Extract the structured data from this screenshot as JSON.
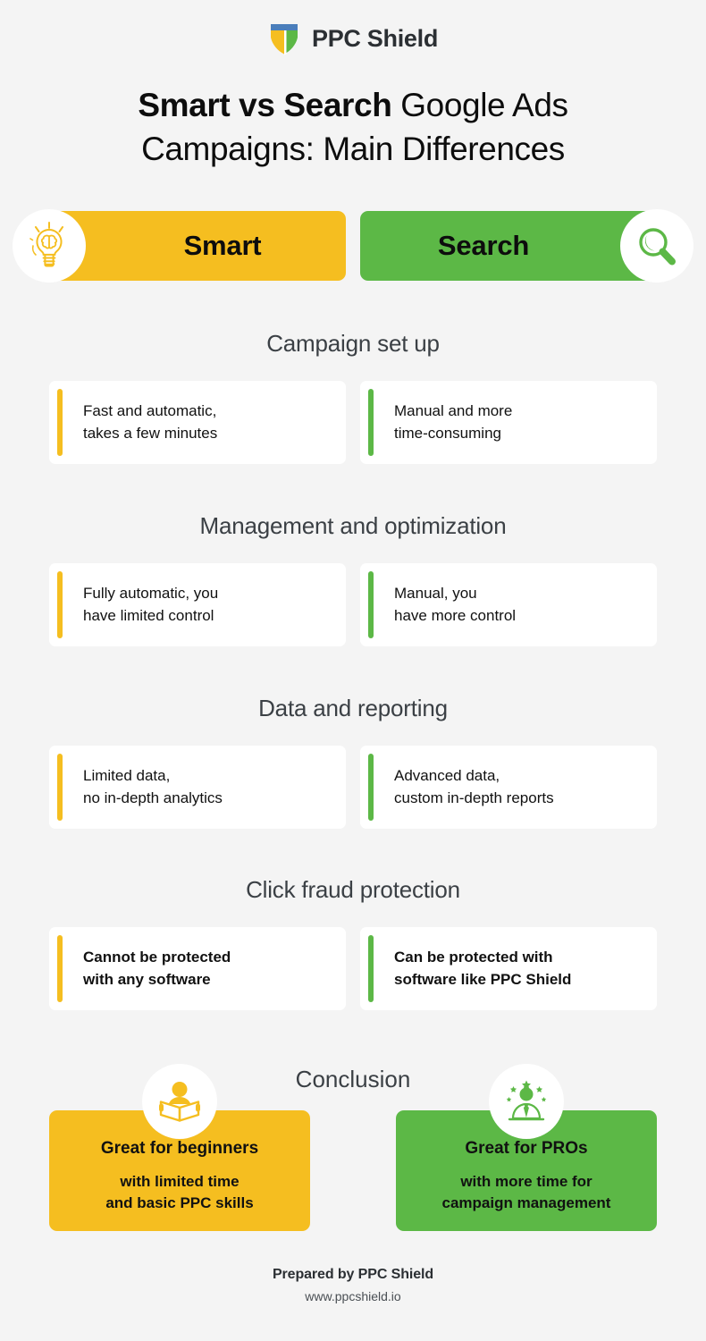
{
  "brand": {
    "logo_icon": "shield-icon",
    "name": "PPC Shield",
    "shield_colors": {
      "blue": "#4a7ebb",
      "yellow": "#f5be20",
      "green": "#5cb846"
    }
  },
  "title": {
    "bold_part": "Smart vs Search",
    "rest_part": " Google Ads",
    "line2": "Campaigns: Main Differences"
  },
  "columns": {
    "smart": {
      "label": "Smart",
      "color": "#f5be20",
      "icon": "lightbulb-brain-icon"
    },
    "search": {
      "label": "Search",
      "color": "#5cb846",
      "icon": "magnifying-glass-icon"
    }
  },
  "sections": [
    {
      "title": "Campaign set up",
      "smart": "Fast and automatic,\ntakes a few minutes",
      "search": "Manual and more\ntime-consuming",
      "bold": false
    },
    {
      "title": "Management and optimization",
      "smart": "Fully automatic, you\nhave limited control",
      "search": "Manual, you\nhave more control",
      "bold": false
    },
    {
      "title": "Data and reporting",
      "smart": "Limited data,\nno in-depth analytics",
      "search": "Advanced data,\ncustom in-depth reports",
      "bold": false
    },
    {
      "title": "Click fraud protection",
      "smart": "Cannot be protected\nwith any software",
      "search": "Can be protected with\nsoftware like PPC Shield",
      "bold": true
    }
  ],
  "conclusion": {
    "title": "Conclusion",
    "smart": {
      "icon": "person-reading-book-icon",
      "heading": "Great for beginners",
      "body": "with limited time\nand basic PPC skills"
    },
    "search": {
      "icon": "professional-with-stars-icon",
      "heading": "Great for PROs",
      "body": "with more time for\ncampaign management"
    }
  },
  "footer": {
    "prepared_by": "Prepared by PPC Shield",
    "url": "www.ppcshield.io"
  }
}
